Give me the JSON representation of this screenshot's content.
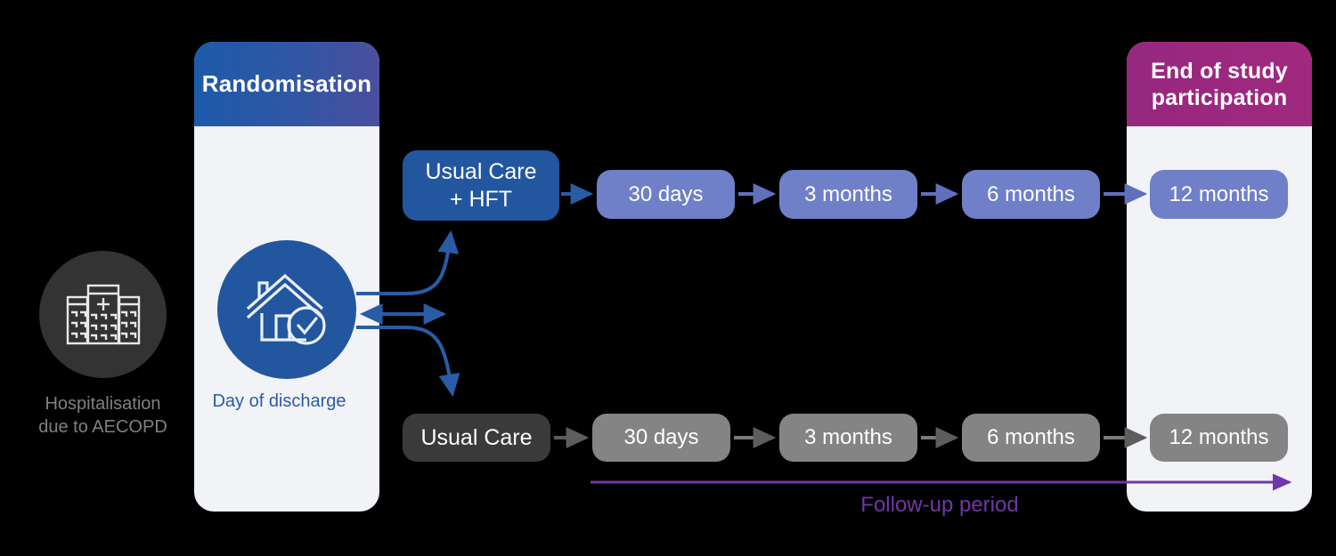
{
  "diagram": {
    "title": "AECOPD home high-flow therapy study flow diagram",
    "colors": {
      "panel_background": "#f1f3f7",
      "randomisation_header_start": "#1c5aaa",
      "randomisation_header_end": "#4a4f9e",
      "end_of_study_header": "#9c2a8a",
      "arm_hft": "#22569e",
      "visit_blue": "#6f80c8",
      "arm_usual_care": "#3a3a3a",
      "visit_gray": "#848484",
      "hospital_circle": "#333333",
      "discharge_circle": "#22569e",
      "followup_purple": "#7136a8",
      "canvas_background": "#000000"
    }
  },
  "left_panel": {
    "header": "Randomisation",
    "node_label": "Day of discharge",
    "node_icon": "house-check-icon"
  },
  "right_panel": {
    "header_line1": "End of study",
    "header_line2": "participation"
  },
  "entry": {
    "icon": "hospital-building-icon",
    "label_line1": "Hospitalisation",
    "label_line2": "due to AECOPD"
  },
  "arms": [
    {
      "id": "intervention",
      "label_line1": "Usual Care",
      "label_line2": "+ HFT",
      "visits": [
        "30 days",
        "3 months",
        "6 months",
        "12 months"
      ]
    },
    {
      "id": "control",
      "label_line1": "Usual Care",
      "label_line2": "",
      "visits": [
        "30 days",
        "3 months",
        "6 months",
        "12 months"
      ]
    }
  ],
  "followup": {
    "label": "Follow-up period"
  }
}
